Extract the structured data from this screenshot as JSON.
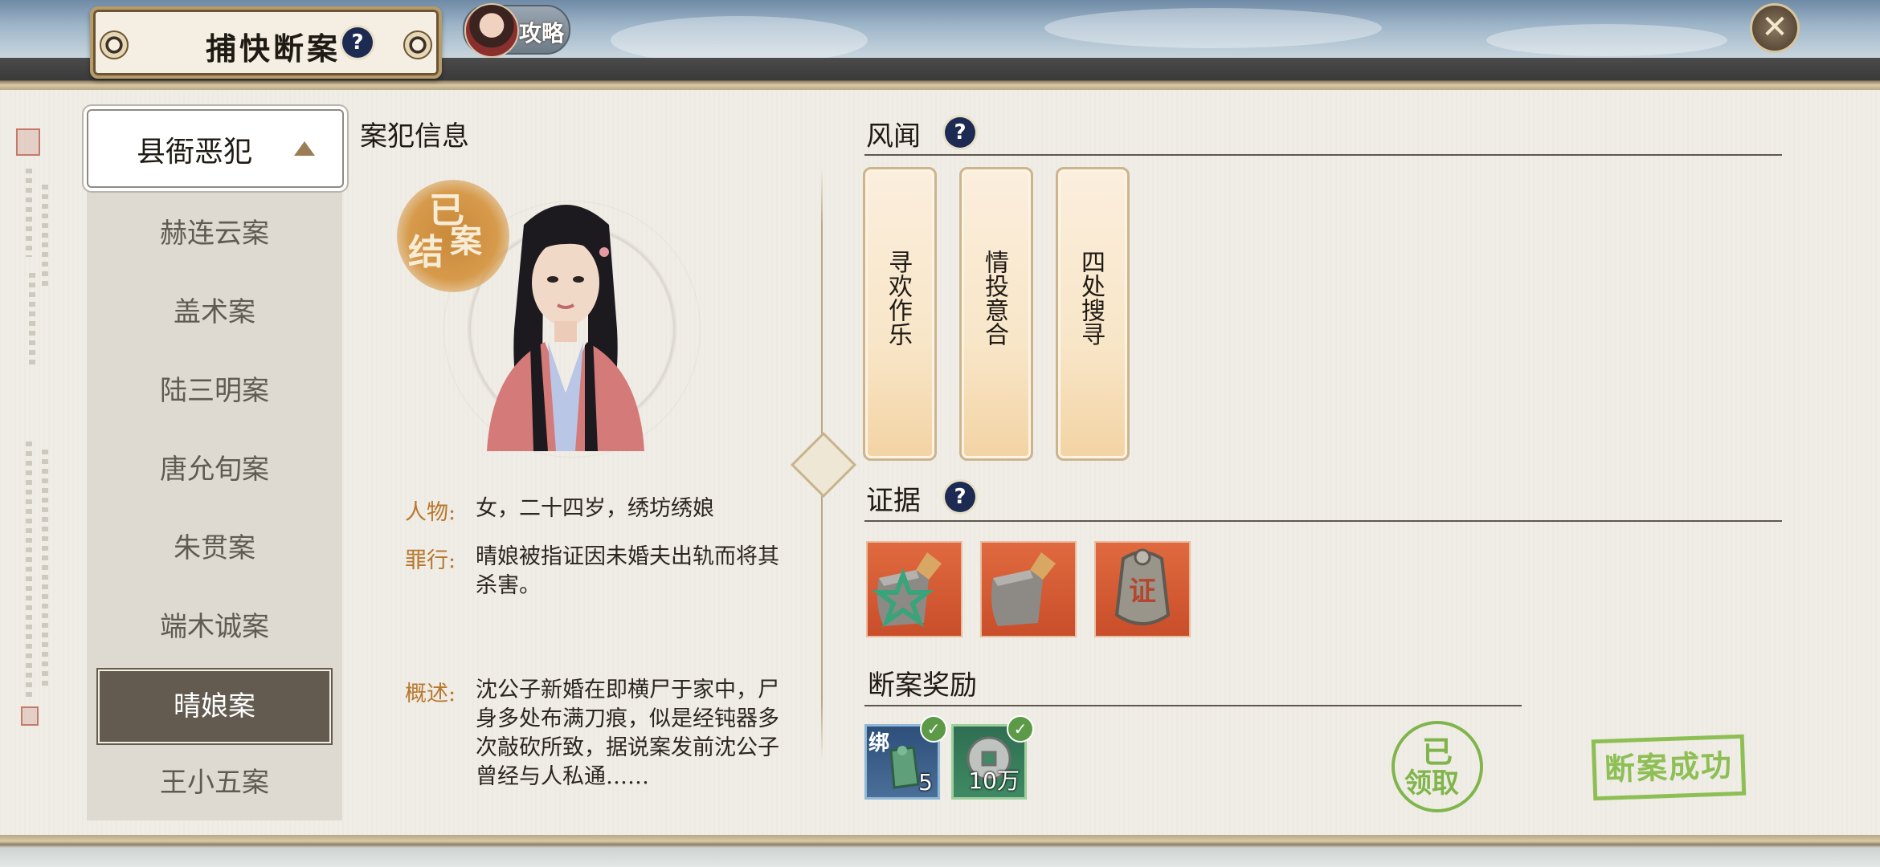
{
  "header": {
    "title": "捕快断案",
    "help_icon": "question-icon",
    "guide_label": "攻略",
    "close_icon": "close-icon"
  },
  "case_list": {
    "category": "县衙恶犯",
    "items": [
      "赫连云案",
      "盖术案",
      "陆三明案",
      "唐允旬案",
      "朱贯案",
      "端木诚案",
      "晴娘案",
      "王小五案"
    ],
    "selected": "晴娘案"
  },
  "suspect": {
    "heading": "案犯信息",
    "stamp_text": [
      "已",
      "结",
      "案"
    ],
    "person_label": "人物:",
    "person_value": "女，二十四岁，绣坊绣娘",
    "crime_label": "罪行:",
    "crime_value": "晴娘被指证因未婚夫出轨而将其杀害。",
    "summary_label": "概述:",
    "summary_value": "沈公子新婚在即横尸于家中，尸身多处布满刀痕，似是经钝器多次敲砍所致，据说案发前沈公子曾经与人私通……"
  },
  "rumors": {
    "title": "风闻",
    "cards": [
      "寻欢作乐",
      "情投意合",
      "四处搜寻"
    ]
  },
  "evidence": {
    "title": "证据",
    "items": [
      {
        "icon": "cleaver-star-icon"
      },
      {
        "icon": "cleaver-icon"
      },
      {
        "icon": "evidence-token-icon",
        "label": "证"
      }
    ]
  },
  "rewards": {
    "title": "断案奖励",
    "items": [
      {
        "icon": "jade-token-icon",
        "bound_label": "绑",
        "qty": "5"
      },
      {
        "icon": "coin-icon",
        "qty": "10万"
      }
    ],
    "claimed_stamp": [
      "已",
      "领取"
    ],
    "success_stamp": "断案成功"
  },
  "colors": {
    "accent_label": "#b7772e",
    "selected_item": "#635b50",
    "help_badge": "#1d2a52",
    "stamp_green": "#8dbf55",
    "evidence_bg": "#d9582f"
  }
}
